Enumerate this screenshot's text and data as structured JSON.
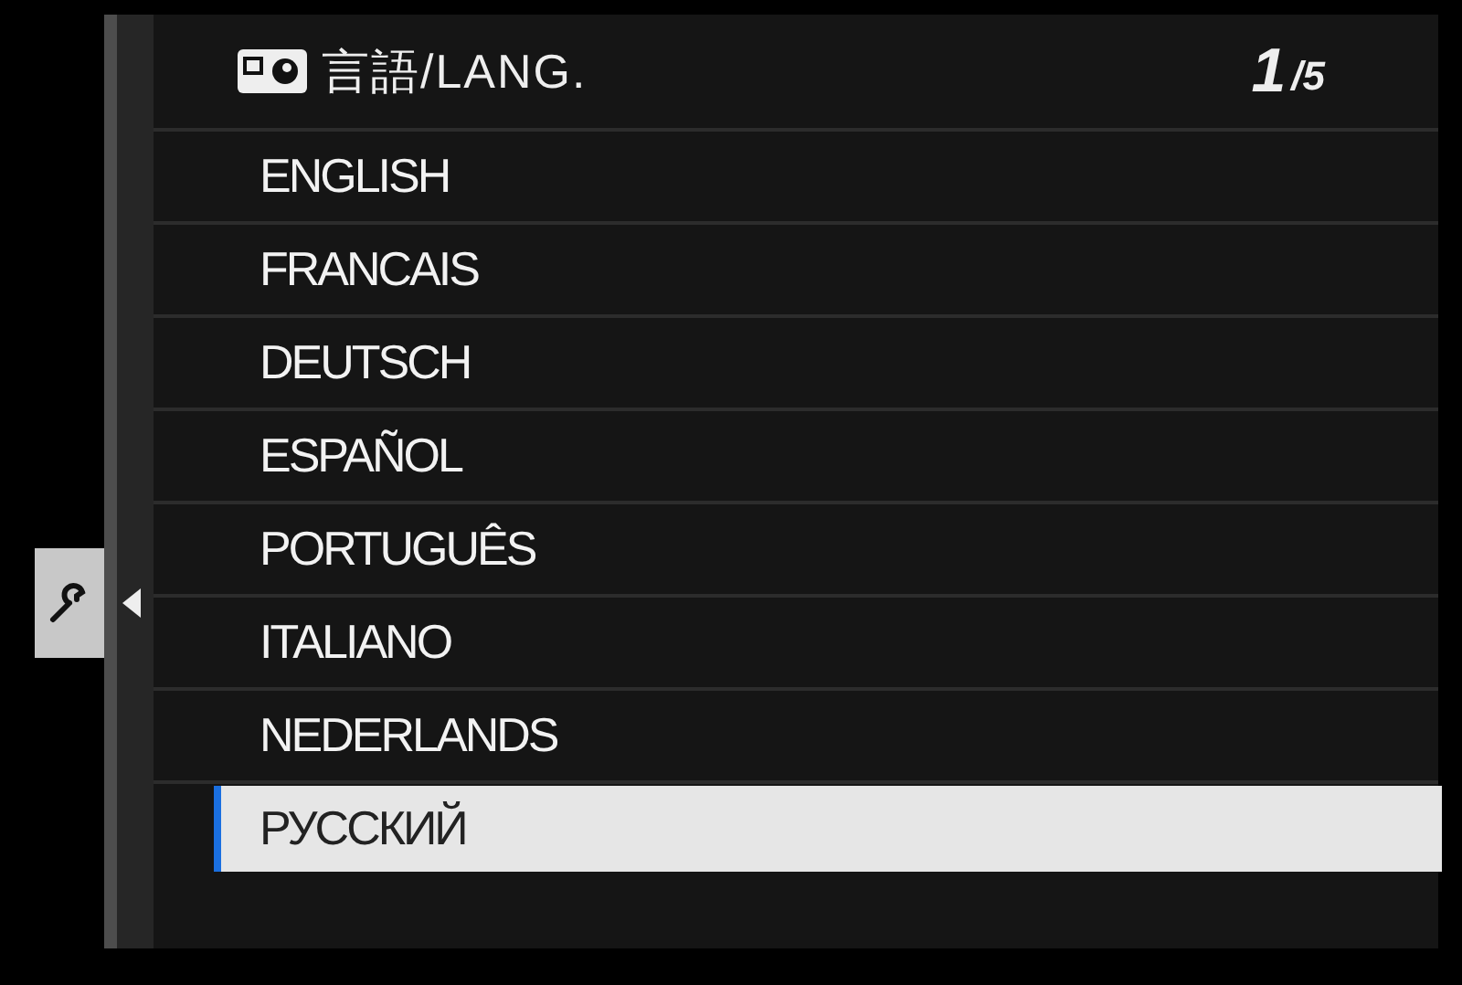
{
  "header": {
    "title": "言語/LANG.",
    "page_current": "1",
    "page_total": "/5"
  },
  "items": [
    {
      "label": "ENGLISH",
      "selected": false
    },
    {
      "label": "FRANCAIS",
      "selected": false
    },
    {
      "label": "DEUTSCH",
      "selected": false
    },
    {
      "label": "ESPAÑOL",
      "selected": false
    },
    {
      "label": "PORTUGUÊS",
      "selected": false
    },
    {
      "label": "ITALIANO",
      "selected": false
    },
    {
      "label": "NEDERLANDS",
      "selected": false
    },
    {
      "label": "РУССКИЙ",
      "selected": true
    }
  ]
}
